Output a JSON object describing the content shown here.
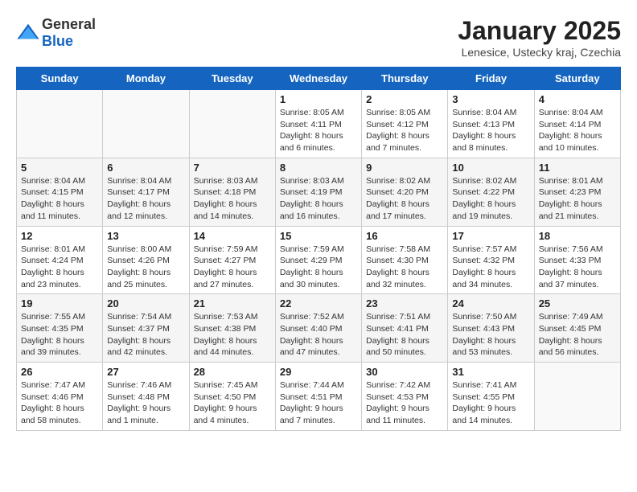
{
  "header": {
    "logo_general": "General",
    "logo_blue": "Blue",
    "title": "January 2025",
    "location": "Lenesice, Ustecky kraj, Czechia"
  },
  "weekdays": [
    "Sunday",
    "Monday",
    "Tuesday",
    "Wednesday",
    "Thursday",
    "Friday",
    "Saturday"
  ],
  "weeks": [
    [
      {
        "day": "",
        "info": ""
      },
      {
        "day": "",
        "info": ""
      },
      {
        "day": "",
        "info": ""
      },
      {
        "day": "1",
        "info": "Sunrise: 8:05 AM\nSunset: 4:11 PM\nDaylight: 8 hours\nand 6 minutes."
      },
      {
        "day": "2",
        "info": "Sunrise: 8:05 AM\nSunset: 4:12 PM\nDaylight: 8 hours\nand 7 minutes."
      },
      {
        "day": "3",
        "info": "Sunrise: 8:04 AM\nSunset: 4:13 PM\nDaylight: 8 hours\nand 8 minutes."
      },
      {
        "day": "4",
        "info": "Sunrise: 8:04 AM\nSunset: 4:14 PM\nDaylight: 8 hours\nand 10 minutes."
      }
    ],
    [
      {
        "day": "5",
        "info": "Sunrise: 8:04 AM\nSunset: 4:15 PM\nDaylight: 8 hours\nand 11 minutes."
      },
      {
        "day": "6",
        "info": "Sunrise: 8:04 AM\nSunset: 4:17 PM\nDaylight: 8 hours\nand 12 minutes."
      },
      {
        "day": "7",
        "info": "Sunrise: 8:03 AM\nSunset: 4:18 PM\nDaylight: 8 hours\nand 14 minutes."
      },
      {
        "day": "8",
        "info": "Sunrise: 8:03 AM\nSunset: 4:19 PM\nDaylight: 8 hours\nand 16 minutes."
      },
      {
        "day": "9",
        "info": "Sunrise: 8:02 AM\nSunset: 4:20 PM\nDaylight: 8 hours\nand 17 minutes."
      },
      {
        "day": "10",
        "info": "Sunrise: 8:02 AM\nSunset: 4:22 PM\nDaylight: 8 hours\nand 19 minutes."
      },
      {
        "day": "11",
        "info": "Sunrise: 8:01 AM\nSunset: 4:23 PM\nDaylight: 8 hours\nand 21 minutes."
      }
    ],
    [
      {
        "day": "12",
        "info": "Sunrise: 8:01 AM\nSunset: 4:24 PM\nDaylight: 8 hours\nand 23 minutes."
      },
      {
        "day": "13",
        "info": "Sunrise: 8:00 AM\nSunset: 4:26 PM\nDaylight: 8 hours\nand 25 minutes."
      },
      {
        "day": "14",
        "info": "Sunrise: 7:59 AM\nSunset: 4:27 PM\nDaylight: 8 hours\nand 27 minutes."
      },
      {
        "day": "15",
        "info": "Sunrise: 7:59 AM\nSunset: 4:29 PM\nDaylight: 8 hours\nand 30 minutes."
      },
      {
        "day": "16",
        "info": "Sunrise: 7:58 AM\nSunset: 4:30 PM\nDaylight: 8 hours\nand 32 minutes."
      },
      {
        "day": "17",
        "info": "Sunrise: 7:57 AM\nSunset: 4:32 PM\nDaylight: 8 hours\nand 34 minutes."
      },
      {
        "day": "18",
        "info": "Sunrise: 7:56 AM\nSunset: 4:33 PM\nDaylight: 8 hours\nand 37 minutes."
      }
    ],
    [
      {
        "day": "19",
        "info": "Sunrise: 7:55 AM\nSunset: 4:35 PM\nDaylight: 8 hours\nand 39 minutes."
      },
      {
        "day": "20",
        "info": "Sunrise: 7:54 AM\nSunset: 4:37 PM\nDaylight: 8 hours\nand 42 minutes."
      },
      {
        "day": "21",
        "info": "Sunrise: 7:53 AM\nSunset: 4:38 PM\nDaylight: 8 hours\nand 44 minutes."
      },
      {
        "day": "22",
        "info": "Sunrise: 7:52 AM\nSunset: 4:40 PM\nDaylight: 8 hours\nand 47 minutes."
      },
      {
        "day": "23",
        "info": "Sunrise: 7:51 AM\nSunset: 4:41 PM\nDaylight: 8 hours\nand 50 minutes."
      },
      {
        "day": "24",
        "info": "Sunrise: 7:50 AM\nSunset: 4:43 PM\nDaylight: 8 hours\nand 53 minutes."
      },
      {
        "day": "25",
        "info": "Sunrise: 7:49 AM\nSunset: 4:45 PM\nDaylight: 8 hours\nand 56 minutes."
      }
    ],
    [
      {
        "day": "26",
        "info": "Sunrise: 7:47 AM\nSunset: 4:46 PM\nDaylight: 8 hours\nand 58 minutes."
      },
      {
        "day": "27",
        "info": "Sunrise: 7:46 AM\nSunset: 4:48 PM\nDaylight: 9 hours\nand 1 minute."
      },
      {
        "day": "28",
        "info": "Sunrise: 7:45 AM\nSunset: 4:50 PM\nDaylight: 9 hours\nand 4 minutes."
      },
      {
        "day": "29",
        "info": "Sunrise: 7:44 AM\nSunset: 4:51 PM\nDaylight: 9 hours\nand 7 minutes."
      },
      {
        "day": "30",
        "info": "Sunrise: 7:42 AM\nSunset: 4:53 PM\nDaylight: 9 hours\nand 11 minutes."
      },
      {
        "day": "31",
        "info": "Sunrise: 7:41 AM\nSunset: 4:55 PM\nDaylight: 9 hours\nand 14 minutes."
      },
      {
        "day": "",
        "info": ""
      }
    ]
  ]
}
